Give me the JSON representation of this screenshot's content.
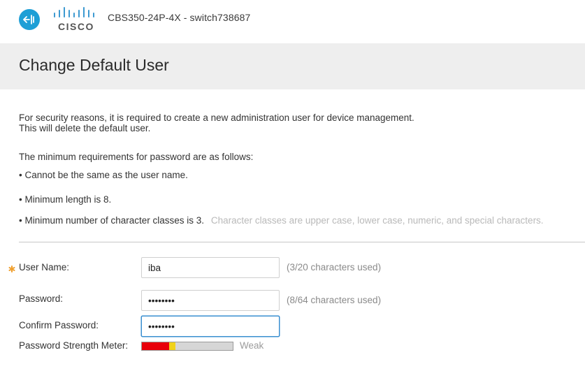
{
  "header": {
    "device_title": "CBS350-24P-4X - switch738687",
    "logo_text": "CISCO",
    "back_icon": "exit-arrow-icon",
    "brand_color": "#1e9fd6"
  },
  "page": {
    "title": "Change Default User",
    "intro_line1": "For security reasons, it is required to create a new administration user for device management.",
    "intro_line2": "This will delete the default user.",
    "requirements_heading": "The minimum requirements for password are as follows:",
    "requirement_1": "• Cannot be the same as the user name.",
    "requirement_2": "• Minimum length is 8.",
    "requirement_3": "• Minimum number of character classes is 3.",
    "requirement_3_hint": "Character classes are upper case, lower case, numeric, and special characters."
  },
  "form": {
    "username_label": "User Name:",
    "username_value": "iba",
    "username_count": "(3/20 characters used)",
    "password_label": "Password:",
    "password_value": "••••••••",
    "password_count": "(8/64 characters used)",
    "confirm_label": "Confirm Password:",
    "confirm_value": "••••••••",
    "meter_label": "Password Strength Meter:",
    "meter_text": "Weak",
    "meter_red_fraction": 0.3,
    "meter_yellow_fraction": 0.07,
    "meter_colors": {
      "red": "#e8000b",
      "yellow": "#f1d21a",
      "empty": "#d6d6d6"
    },
    "required_color": "#f0a030"
  }
}
